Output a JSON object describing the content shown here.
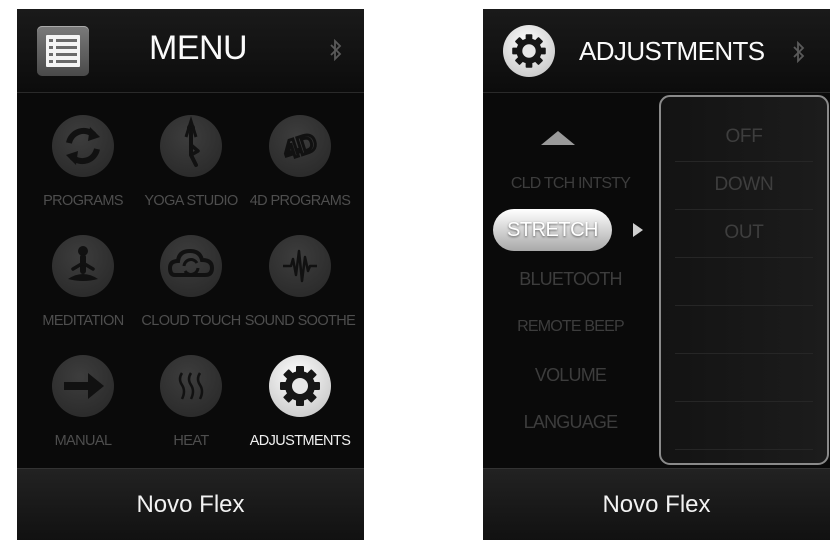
{
  "left": {
    "title": "MENU",
    "menu_icon": "list-menu-icon",
    "bluetooth_icon": "bluetooth-icon",
    "items": [
      {
        "label": "PROGRAMS",
        "icon": "refresh-arrows-icon",
        "active": false
      },
      {
        "label": "YOGA STUDIO",
        "icon": "yoga-pose-icon",
        "active": false
      },
      {
        "label": "4D PROGRAMS",
        "icon": "4d-icon",
        "active": false
      },
      {
        "label": "MEDITATION",
        "icon": "meditation-icon",
        "active": false
      },
      {
        "label": "CLOUD TOUCH",
        "icon": "cloud-touch-icon",
        "active": false
      },
      {
        "label": "SOUND SOOTHE",
        "icon": "sound-wave-icon",
        "active": false
      },
      {
        "label": "MANUAL",
        "icon": "arrow-right-icon",
        "active": false
      },
      {
        "label": "HEAT",
        "icon": "heat-waves-icon",
        "active": false
      },
      {
        "label": "ADJUSTMENTS",
        "icon": "gear-icon",
        "active": true
      }
    ],
    "footer": "Novo Flex"
  },
  "right": {
    "title": "ADJUSTMENTS",
    "gear_icon": "gear-icon",
    "bluetooth_icon": "bluetooth-icon",
    "settings": [
      "CLD TCH INTSTY",
      "STRETCH",
      "BLUETOOTH",
      "REMOTE BEEP",
      "VOLUME",
      "LANGUAGE"
    ],
    "selected_setting": "STRETCH",
    "options": [
      "OFF",
      "DOWN",
      "OUT",
      "",
      "",
      "",
      ""
    ],
    "footer": "Novo Flex"
  },
  "colors": {
    "screen_bg": "#0a0a0a",
    "inactive_text": "#4e4e4e",
    "active_text": "#f0f0f0",
    "panel_border": "#8a8a8a"
  }
}
